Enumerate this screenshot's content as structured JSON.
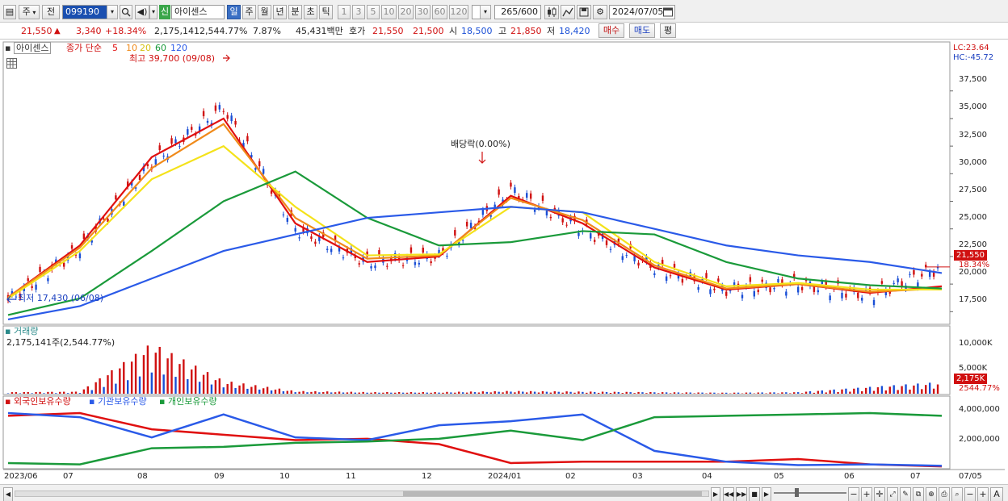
{
  "toolbar": {
    "market_label": "주",
    "prev_label": "전",
    "code_value": "099190",
    "stock_badge": "신",
    "stock_name": "아이센스",
    "periods": [
      "일",
      "주",
      "월",
      "년",
      "분",
      "초",
      "틱"
    ],
    "intervals": [
      "1",
      "3",
      "5",
      "10",
      "20",
      "30",
      "60",
      "120"
    ],
    "count_value": "265",
    "count_max": "/600",
    "date_value": "2024/07/05"
  },
  "quote": {
    "price": "21,550",
    "change_arrow": "▲",
    "change": "3,340",
    "change_pct": "+18.34%",
    "volume": "2,175,141",
    "volume_ratio": "2,544.77%",
    "turnover_pct": "7.87%",
    "amount": "45,431백만",
    "bid_label": "호가",
    "bid1": "21,550",
    "bid2": "21,500",
    "open_label": "시",
    "open": "18,500",
    "high_label": "고",
    "high": "21,850",
    "low_label": "저",
    "low": "18,420",
    "buy_label": "매수",
    "sell_label": "매도",
    "eval_label": "평"
  },
  "price_panel": {
    "stock_tag": "아이센스",
    "ma_title": "종가 단순",
    "ma_periods": [
      "5",
      "10",
      "20",
      "60",
      "120"
    ],
    "max_label": "최고 39,700 (09/08)",
    "min_label": "최저 17,430 (06/08)",
    "dividend_label": "배당락(0.00%)",
    "lc_label": "LC:23.64",
    "hc_label": "HC:-45.72",
    "last_price": "21,550",
    "last_pct": "18.34%",
    "y_ticks": [
      "37,500",
      "35,000",
      "32,500",
      "30,000",
      "27,500",
      "25,000",
      "22,500",
      "20,000",
      "17,500"
    ]
  },
  "volume_panel": {
    "title": "거래량",
    "readout": "2,175,141주(2,544.77%)",
    "y_ticks": [
      "10,000K",
      "5,000K"
    ],
    "last_value": "2,175K",
    "last_pct": "2544.77%"
  },
  "holdings_panel": {
    "legend": [
      "외국인보유수량",
      "기관보유수량",
      "개인보유수량"
    ],
    "y_ticks": [
      "4,000,000",
      "2,000,000"
    ]
  },
  "x_axis": {
    "labels": [
      "2023/06",
      "07",
      "08",
      "09",
      "10",
      "11",
      "12",
      "2024/01",
      "02",
      "03",
      "04",
      "05",
      "06",
      "07"
    ],
    "right_label": "07/05"
  },
  "colors": {
    "up": "#d01010",
    "down": "#1a4fd6",
    "ma5": "#e01010",
    "ma10": "#f08a1a",
    "ma20": "#f4e21a",
    "ma60": "#1a9a3a",
    "ma120": "#2a5ae8",
    "foreign": "#e01010",
    "institution": "#2a5ae8",
    "individual": "#1a9a3a"
  },
  "chart_data": {
    "type": "line",
    "x": [
      "2023/06",
      "07",
      "08",
      "09",
      "10",
      "11",
      "12",
      "2024/01",
      "02",
      "03",
      "04",
      "05",
      "06",
      "07"
    ],
    "series": [
      {
        "name": "종가",
        "values": [
          18500,
          23200,
          31000,
          36000,
          25000,
          22000,
          22500,
          28500,
          25000,
          21500,
          19500,
          20000,
          19000,
          21550
        ]
      },
      {
        "name": "5",
        "values": [
          18800,
          23500,
          31500,
          35000,
          25500,
          22000,
          22500,
          28000,
          25500,
          21500,
          19500,
          20000,
          19200,
          19800
        ]
      },
      {
        "name": "10",
        "values": [
          18800,
          23300,
          30500,
          34500,
          26000,
          22300,
          22600,
          27800,
          25800,
          21700,
          19600,
          20000,
          19300,
          19600
        ]
      },
      {
        "name": "20",
        "values": [
          18700,
          23000,
          29500,
          32500,
          27000,
          22600,
          22700,
          27000,
          26500,
          22000,
          19800,
          20100,
          19500,
          19500
        ]
      },
      {
        "name": "60",
        "values": [
          17200,
          18700,
          23000,
          27500,
          30200,
          26000,
          23500,
          23800,
          24800,
          24500,
          22000,
          20500,
          19900,
          19600
        ]
      },
      {
        "name": "120",
        "values": [
          16800,
          18000,
          20500,
          23000,
          24500,
          26000,
          26500,
          27000,
          26500,
          25000,
          23500,
          22600,
          22000,
          21000
        ]
      }
    ],
    "volume": {
      "values": [
        300,
        400,
        9500,
        2400,
        500,
        300,
        300,
        500,
        400,
        300,
        200,
        300,
        1300,
        2175
      ],
      "unit": "K"
    },
    "holdings": {
      "x": [
        "2023/06",
        "07",
        "08",
        "09",
        "10",
        "11",
        "12",
        "2024/01",
        "02",
        "03",
        "04",
        "05",
        "06",
        "07"
      ],
      "series": [
        {
          "name": "외국인보유수량",
          "values": [
            3800000,
            4000000,
            2800000,
            2400000,
            2000000,
            2100000,
            1700000,
            300000,
            400000,
            400000,
            400000,
            600000,
            200000,
            50000
          ]
        },
        {
          "name": "기관보유수량",
          "values": [
            4000000,
            3700000,
            2200000,
            3900000,
            2200000,
            2000000,
            3100000,
            3400000,
            3900000,
            1200000,
            400000,
            150000,
            200000,
            100000
          ]
        },
        {
          "name": "개인보유수량",
          "values": [
            300000,
            200000,
            1400000,
            1500000,
            1800000,
            1900000,
            2100000,
            2700000,
            2000000,
            3700000,
            3800000,
            3900000,
            4000000,
            3800000
          ]
        }
      ],
      "ylim": [
        0,
        4600000
      ]
    },
    "ylim": [
      16500,
      41500
    ],
    "y_ticks": [
      17500,
      20000,
      22500,
      25000,
      27500,
      30000,
      32500,
      35000,
      37500
    ]
  }
}
